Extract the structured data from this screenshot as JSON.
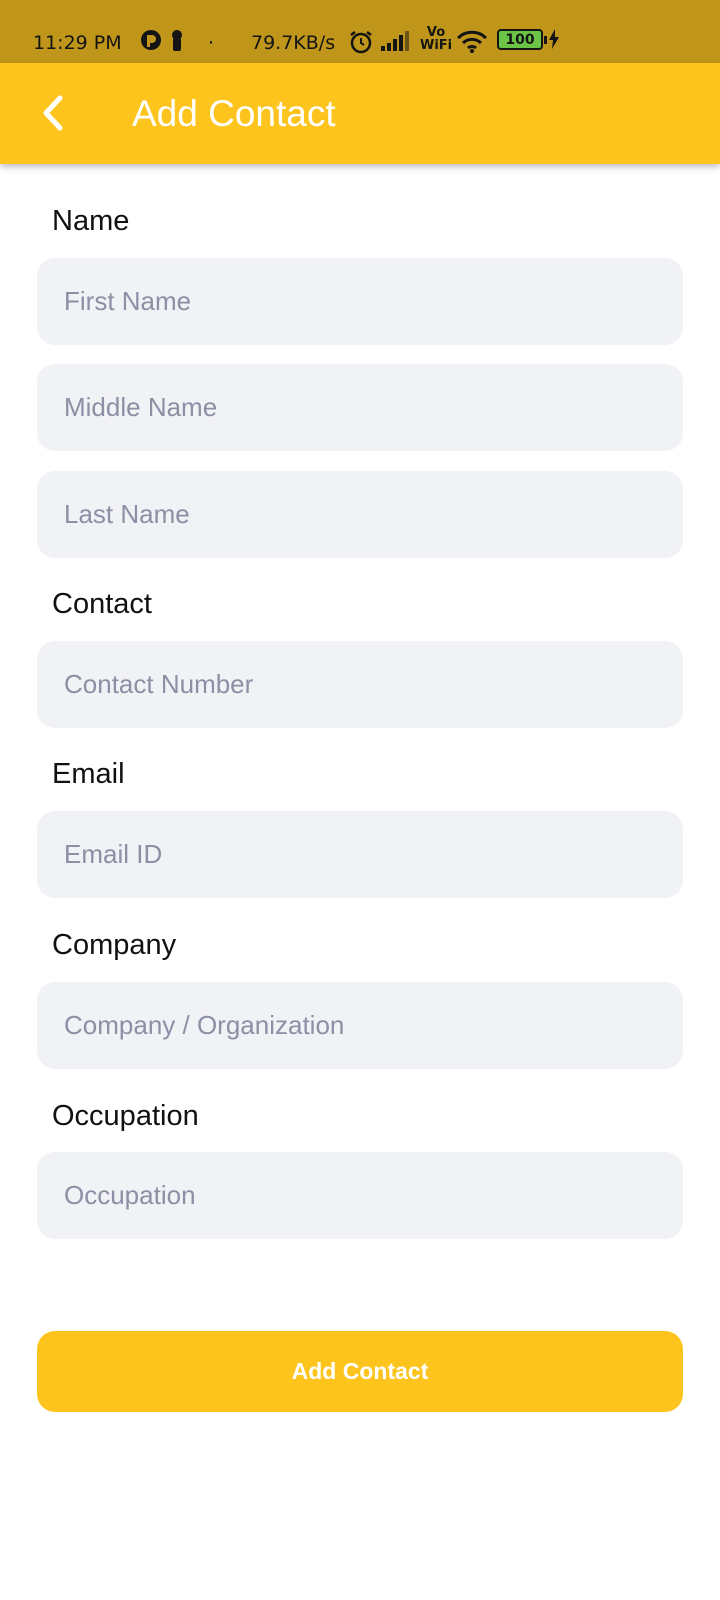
{
  "status_bar": {
    "time": "11:29 PM",
    "dot": "·",
    "net_speed": "79.7KB/s",
    "vowifi_top": "Vo",
    "vowifi_bottom": "WiFi",
    "battery": "100"
  },
  "app_bar": {
    "title": "Add Contact",
    "back_icon": "chevron-left-icon"
  },
  "form": {
    "name_label": "Name",
    "first_name_placeholder": "First Name",
    "middle_name_placeholder": "Middle Name",
    "last_name_placeholder": "Last Name",
    "contact_label": "Contact",
    "contact_number_placeholder": "Contact Number",
    "email_label": "Email",
    "email_placeholder": "Email ID",
    "company_label": "Company",
    "company_placeholder": "Company / Organization",
    "occupation_label": "Occupation",
    "occupation_placeholder": "Occupation",
    "submit_label": "Add Contact"
  },
  "colors": {
    "status_bar_bg": "#bf961a",
    "accent": "#fdc41e",
    "field_bg": "#f1f2f6",
    "placeholder": "#8e8ea4"
  }
}
